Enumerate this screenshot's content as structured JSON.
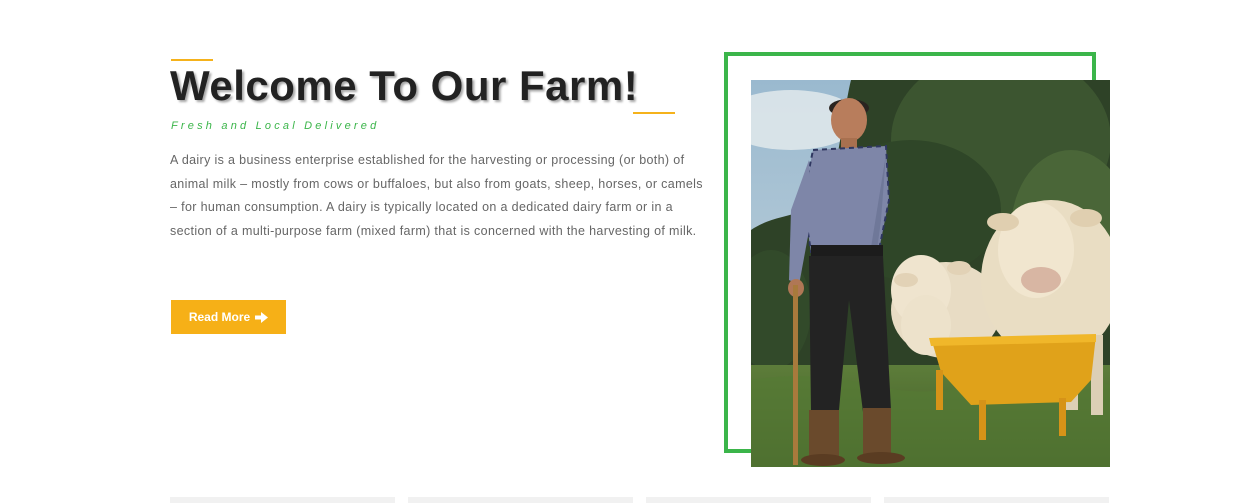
{
  "about": {
    "title": "Welcome To Our Farm!",
    "tagline": "Fresh and Local Delivered",
    "description": "A dairy is a business enterprise established for the harvesting or processing (or both) of animal milk – mostly from cows or buffaloes, but also from goats, sheep, horses, or camels – for human consumption. A dairy is typically located on a dedicated dairy farm or in a section of a multi-purpose farm (mixed farm) that is concerned with the harvesting of milk.",
    "read_more_label": "Read More",
    "read_more_icon": "arrow-right-icon"
  },
  "image": {
    "subject": "farmer-with-cows-photo"
  },
  "colors": {
    "accent_yellow": "#f5b21b",
    "accent_green": "#3bb54a",
    "title": "#222222",
    "body_text": "#666666"
  },
  "feature_cards": [
    {},
    {},
    {},
    {}
  ]
}
